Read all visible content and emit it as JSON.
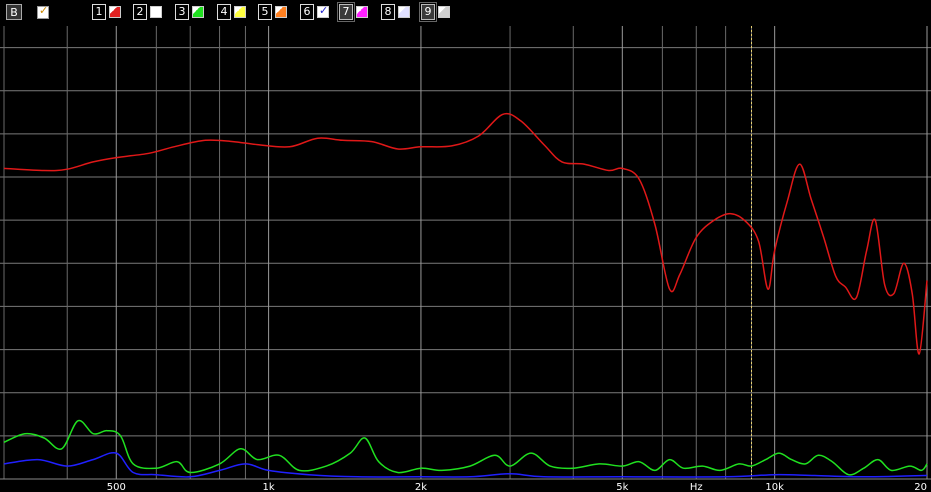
{
  "toolbar": {
    "b_button": "B",
    "traces": [
      {
        "num": "1",
        "color": "#e02020",
        "framed": false
      },
      {
        "num": "2",
        "color": "#ffffff",
        "framed": false
      },
      {
        "num": "3",
        "color": "#20e020",
        "framed": false
      },
      {
        "num": "4",
        "color": "#ffff40",
        "framed": false
      },
      {
        "num": "5",
        "color": "#ff8020",
        "framed": false
      },
      {
        "num": "6",
        "color": "#2020ff",
        "framed": false,
        "checked": true
      },
      {
        "num": "7",
        "color": "#ff20ff",
        "framed": true
      },
      {
        "num": "8",
        "color": "#e0e0ff",
        "framed": false
      },
      {
        "num": "9",
        "color": "#d0d0d0",
        "framed": true
      }
    ]
  },
  "chart_data": {
    "type": "line",
    "xscale": "log",
    "xlim": [
      300,
      20000
    ],
    "grid": true,
    "cursor_x": 9000,
    "x_ticks": [
      {
        "value": 500,
        "label": "500"
      },
      {
        "value": 1000,
        "label": "1k"
      },
      {
        "value": 2000,
        "label": "2k"
      },
      {
        "value": 5000,
        "label": "5k"
      },
      {
        "value": 7000,
        "label": "Hz"
      },
      {
        "value": 10000,
        "label": "10k"
      },
      {
        "value": 20000,
        "label": "20"
      }
    ],
    "ylim": [
      0,
      10.5
    ],
    "y_gridlines": [
      1,
      2,
      3,
      4,
      5,
      6,
      7,
      8,
      9,
      10
    ],
    "series": [
      {
        "color": "#e01818",
        "points": [
          [
            300,
            7.2
          ],
          [
            360,
            7.15
          ],
          [
            400,
            7.18
          ],
          [
            450,
            7.35
          ],
          [
            500,
            7.45
          ],
          [
            580,
            7.55
          ],
          [
            650,
            7.7
          ],
          [
            750,
            7.85
          ],
          [
            850,
            7.82
          ],
          [
            950,
            7.75
          ],
          [
            1100,
            7.7
          ],
          [
            1250,
            7.9
          ],
          [
            1400,
            7.85
          ],
          [
            1600,
            7.82
          ],
          [
            1800,
            7.65
          ],
          [
            2000,
            7.7
          ],
          [
            2300,
            7.72
          ],
          [
            2600,
            7.95
          ],
          [
            2900,
            8.45
          ],
          [
            3150,
            8.3
          ],
          [
            3500,
            7.75
          ],
          [
            3800,
            7.35
          ],
          [
            4200,
            7.3
          ],
          [
            4700,
            7.15
          ],
          [
            5000,
            7.2
          ],
          [
            5400,
            6.95
          ],
          [
            5800,
            5.9
          ],
          [
            6200,
            4.4
          ],
          [
            6500,
            4.75
          ],
          [
            7000,
            5.6
          ],
          [
            7600,
            6.0
          ],
          [
            8200,
            6.15
          ],
          [
            8800,
            5.95
          ],
          [
            9300,
            5.5
          ],
          [
            9700,
            4.4
          ],
          [
            10000,
            5.3
          ],
          [
            10600,
            6.45
          ],
          [
            11200,
            7.3
          ],
          [
            11800,
            6.5
          ],
          [
            12500,
            5.6
          ],
          [
            13200,
            4.7
          ],
          [
            13800,
            4.45
          ],
          [
            14500,
            4.2
          ],
          [
            15200,
            5.3
          ],
          [
            15800,
            6.0
          ],
          [
            16500,
            4.5
          ],
          [
            17200,
            4.3
          ],
          [
            18000,
            5.0
          ],
          [
            18700,
            4.3
          ],
          [
            19300,
            2.9
          ],
          [
            20000,
            4.6
          ]
        ]
      },
      {
        "color": "#20e020",
        "points": [
          [
            300,
            0.85
          ],
          [
            330,
            1.05
          ],
          [
            360,
            0.95
          ],
          [
            390,
            0.7
          ],
          [
            420,
            1.35
          ],
          [
            450,
            1.05
          ],
          [
            480,
            1.12
          ],
          [
            510,
            1.0
          ],
          [
            540,
            0.35
          ],
          [
            600,
            0.25
          ],
          [
            660,
            0.4
          ],
          [
            700,
            0.15
          ],
          [
            800,
            0.35
          ],
          [
            880,
            0.7
          ],
          [
            950,
            0.45
          ],
          [
            1050,
            0.55
          ],
          [
            1150,
            0.2
          ],
          [
            1300,
            0.3
          ],
          [
            1450,
            0.6
          ],
          [
            1550,
            0.95
          ],
          [
            1650,
            0.4
          ],
          [
            1800,
            0.15
          ],
          [
            2000,
            0.25
          ],
          [
            2200,
            0.2
          ],
          [
            2500,
            0.3
          ],
          [
            2800,
            0.55
          ],
          [
            3000,
            0.3
          ],
          [
            3300,
            0.6
          ],
          [
            3600,
            0.3
          ],
          [
            4000,
            0.25
          ],
          [
            4500,
            0.35
          ],
          [
            5000,
            0.3
          ],
          [
            5400,
            0.4
          ],
          [
            5800,
            0.2
          ],
          [
            6200,
            0.45
          ],
          [
            6600,
            0.25
          ],
          [
            7200,
            0.3
          ],
          [
            7800,
            0.2
          ],
          [
            8500,
            0.35
          ],
          [
            9000,
            0.3
          ],
          [
            9600,
            0.45
          ],
          [
            10200,
            0.6
          ],
          [
            10800,
            0.45
          ],
          [
            11500,
            0.35
          ],
          [
            12200,
            0.55
          ],
          [
            13000,
            0.4
          ],
          [
            14000,
            0.1
          ],
          [
            15000,
            0.25
          ],
          [
            16000,
            0.45
          ],
          [
            17000,
            0.2
          ],
          [
            18500,
            0.3
          ],
          [
            19500,
            0.2
          ],
          [
            20000,
            0.35
          ]
        ]
      },
      {
        "color": "#2020ff",
        "points": [
          [
            300,
            0.35
          ],
          [
            350,
            0.45
          ],
          [
            400,
            0.3
          ],
          [
            450,
            0.45
          ],
          [
            500,
            0.6
          ],
          [
            540,
            0.15
          ],
          [
            600,
            0.1
          ],
          [
            700,
            0.05
          ],
          [
            800,
            0.2
          ],
          [
            900,
            0.35
          ],
          [
            1000,
            0.2
          ],
          [
            1200,
            0.1
          ],
          [
            1500,
            0.05
          ],
          [
            2000,
            0.05
          ],
          [
            2500,
            0.05
          ],
          [
            3000,
            0.12
          ],
          [
            3500,
            0.05
          ],
          [
            5000,
            0.05
          ],
          [
            8000,
            0.05
          ],
          [
            10000,
            0.1
          ],
          [
            12000,
            0.08
          ],
          [
            15000,
            0.05
          ],
          [
            20000,
            0.08
          ]
        ]
      }
    ]
  }
}
